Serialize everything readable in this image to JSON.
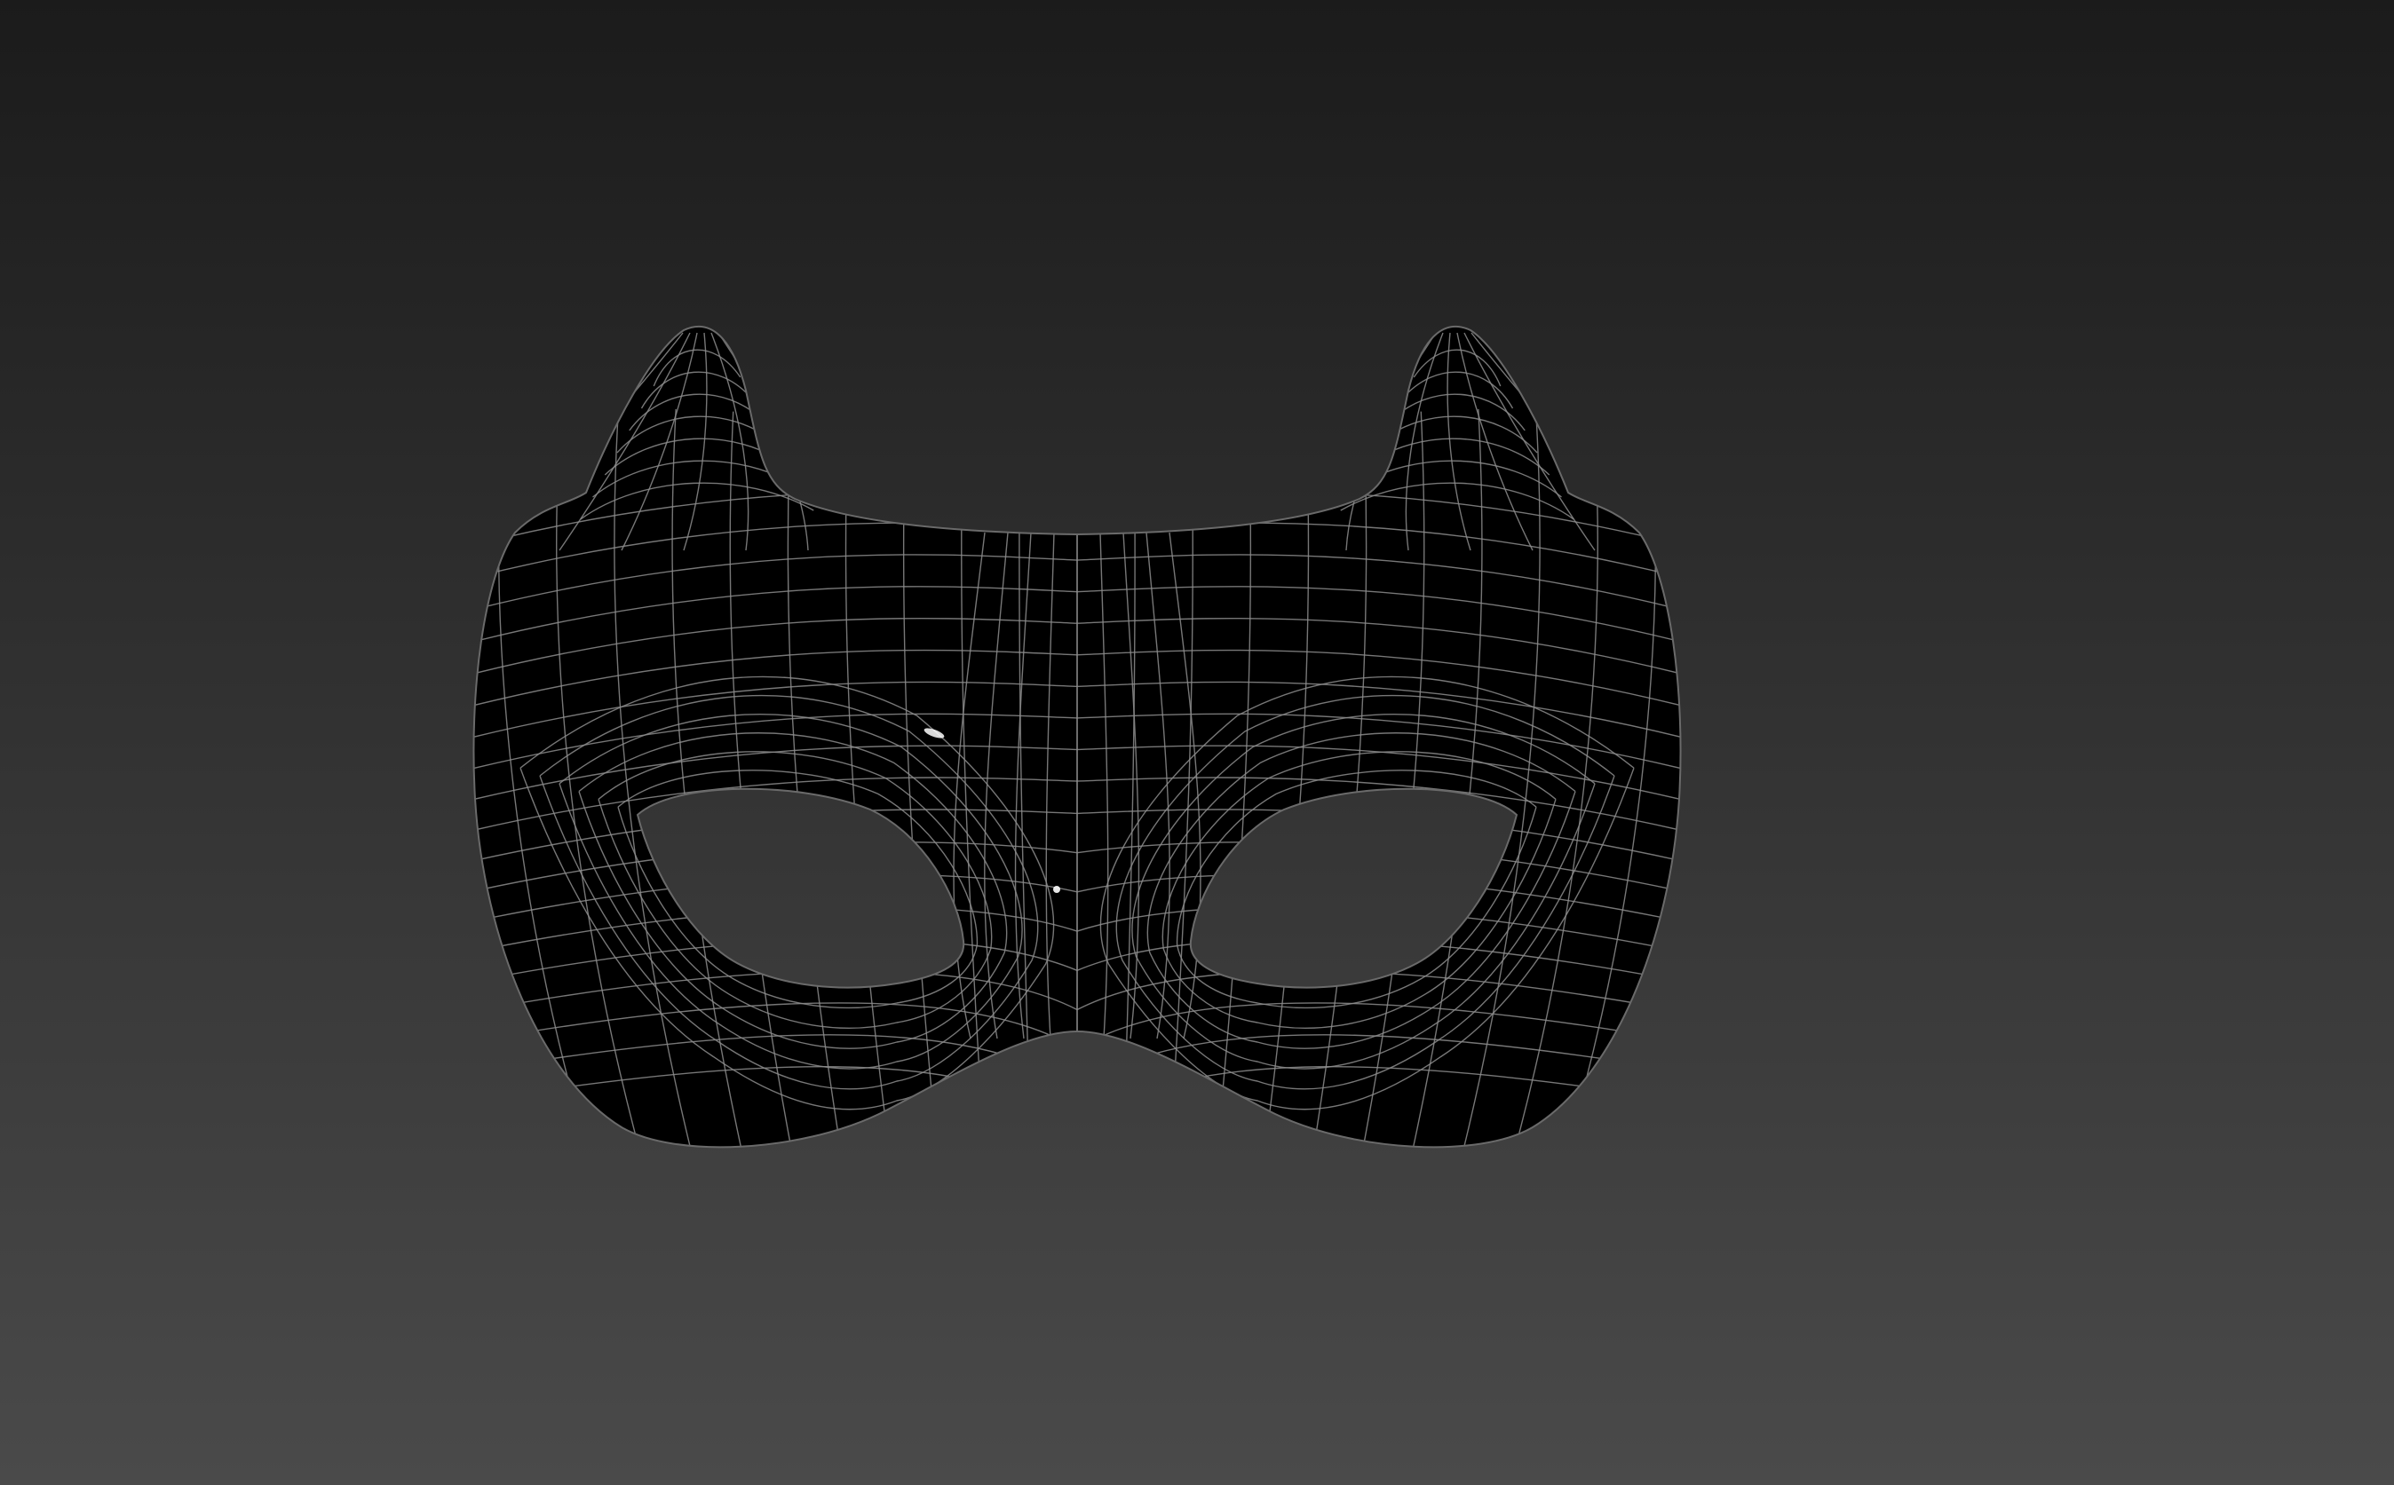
{
  "viewport": {
    "background": {
      "top_color": "#1b1b1b",
      "bottom_color": "#4a4a4a"
    }
  },
  "model": {
    "object": "mask",
    "display_mode": "wireframe-on-shaded",
    "surface_color": "#000000",
    "wire_color": "#8c8c8c",
    "rim_highlight_color": "#5a3a3a"
  }
}
